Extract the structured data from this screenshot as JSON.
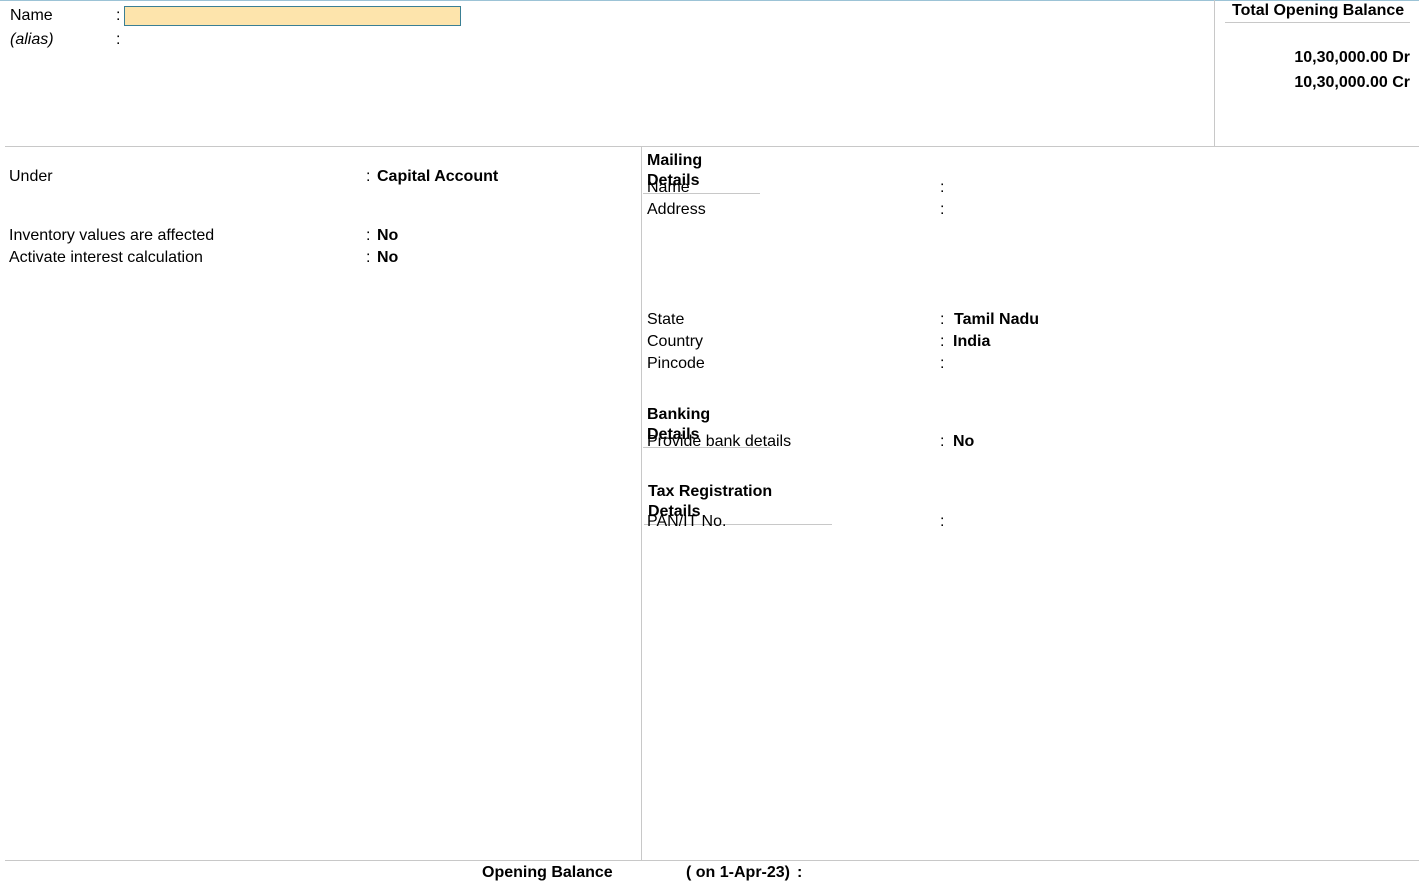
{
  "header": {
    "name_label": "Name",
    "name_value": "",
    "alias_label": "(alias)",
    "colon": ":"
  },
  "total_opening_balance": {
    "title": "Total Opening Balance",
    "debit": "10,30,000.00 Dr",
    "credit": "10,30,000.00 Cr"
  },
  "left": {
    "under_label": "Under",
    "under_value": "Capital Account",
    "inventory_label": "Inventory values are affected",
    "inventory_value": "No",
    "interest_label": "Activate interest calculation",
    "interest_value": "No"
  },
  "mailing": {
    "title": "Mailing Details",
    "name_label": "Name",
    "address_label": "Address",
    "state_label": "State",
    "state_value": "Tamil Nadu",
    "country_label": "Country",
    "country_value": "India",
    "pincode_label": "Pincode"
  },
  "banking": {
    "title": "Banking Details",
    "provide_label": "Provide bank details",
    "provide_value": "No"
  },
  "tax": {
    "title": "Tax Registration Details",
    "pan_label": "PAN/IT No."
  },
  "footer": {
    "opening_label": "Opening Balance",
    "date_text": "( on 1-Apr-23)",
    "colon": ":"
  }
}
